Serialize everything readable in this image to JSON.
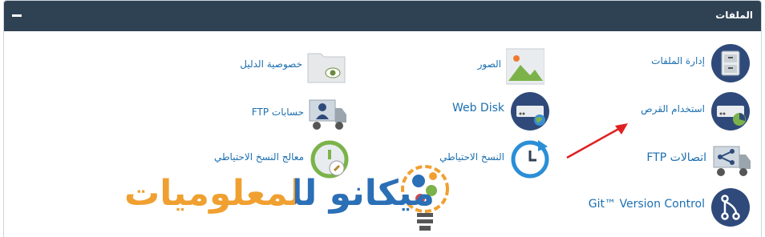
{
  "header": {
    "title": "الملفات",
    "collapse_symbol": "−"
  },
  "items": [
    {
      "label": "إدارة الملفات",
      "icon": "file-cabinet-icon"
    },
    {
      "label": "الصور",
      "icon": "images-icon"
    },
    {
      "label": "خصوصية الدليل",
      "icon": "folder-eye-icon"
    },
    {
      "label": "استخدام القرص",
      "icon": "disk-usage-icon"
    },
    {
      "label": "Web Disk",
      "icon": "web-disk-icon"
    },
    {
      "label": "حسابات FTP",
      "icon": "ftp-accounts-icon"
    },
    {
      "label": "اتصالات FTP",
      "icon": "ftp-connections-icon"
    },
    {
      "label": "النسخ الاحتياطي",
      "icon": "backup-icon"
    },
    {
      "label": "معالج النسخ الاحتياطي",
      "icon": "backup-wizard-icon"
    },
    {
      "label": "Git™ Version Control",
      "icon": "git-icon"
    }
  ],
  "watermark": {
    "text": "ميكانو للمعلوميات",
    "colors": {
      "blue": "#2b6fb6",
      "orange": "#f0a030"
    }
  },
  "colors": {
    "header_bg": "#2f4254",
    "link": "#1c6fb0",
    "icon_circle": "#2f4a7a",
    "arrow": "#e02020"
  }
}
